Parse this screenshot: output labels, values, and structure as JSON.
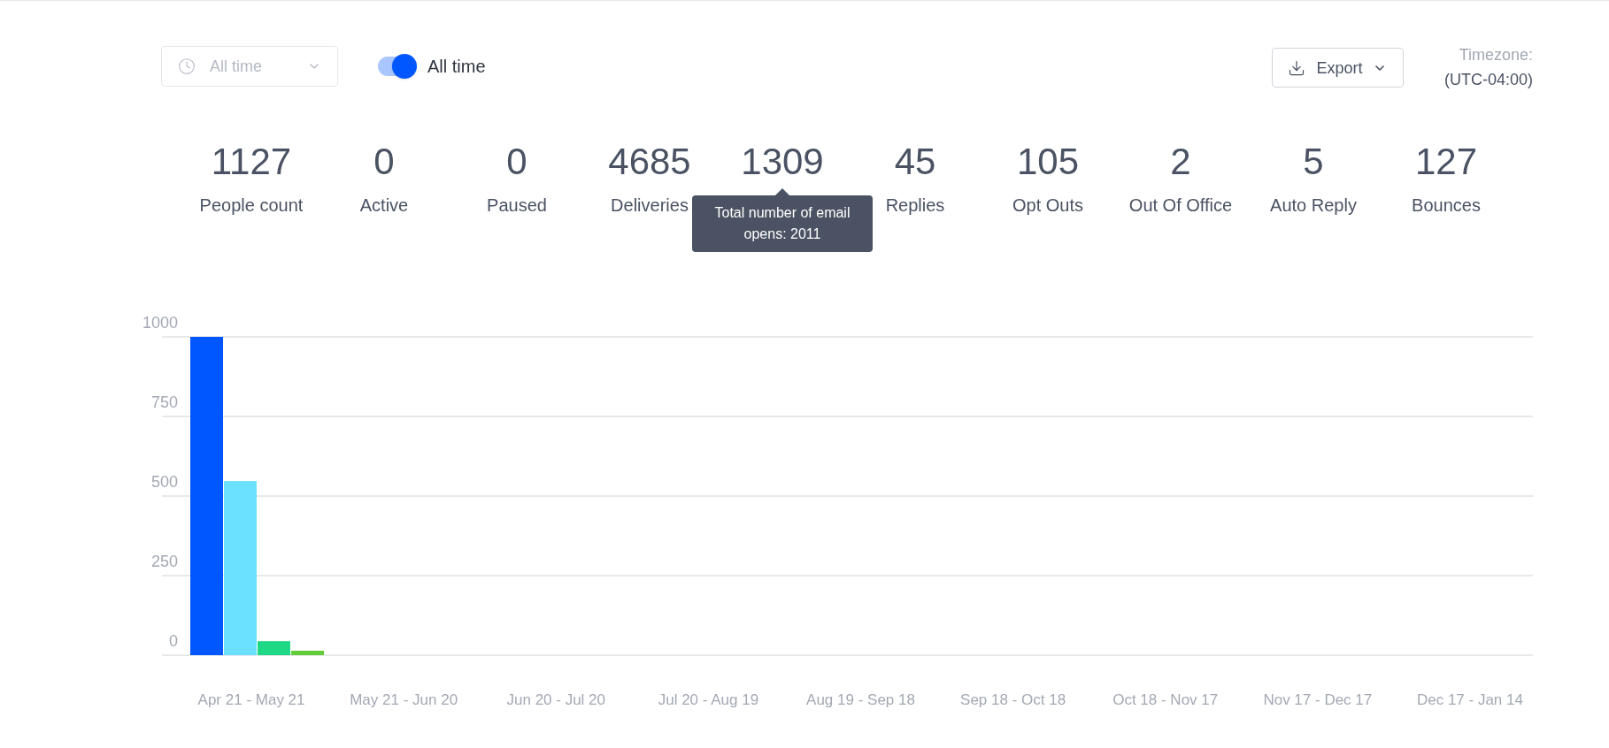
{
  "date_filter": {
    "value": "All time"
  },
  "toggle": {
    "on": true,
    "label": "All time"
  },
  "export_button": {
    "label": "Export"
  },
  "timezone": {
    "label": "Timezone:",
    "value": "(UTC-04:00)"
  },
  "stats": [
    {
      "value": "1127",
      "label": "People count"
    },
    {
      "value": "0",
      "label": "Active"
    },
    {
      "value": "0",
      "label": "Paused"
    },
    {
      "value": "4685",
      "label": "Deliveries"
    },
    {
      "value": "1309",
      "tooltip": "Total number of email opens: 2011"
    },
    {
      "value": "45",
      "label": "Replies"
    },
    {
      "value": "105",
      "label": "Opt Outs"
    },
    {
      "value": "2",
      "label": "Out Of Office"
    },
    {
      "value": "5",
      "label": "Auto Reply"
    },
    {
      "value": "127",
      "label": "Bounces"
    }
  ],
  "chart_data": {
    "type": "bar",
    "categories": [
      "Apr 21 - May 21",
      "May 21 - Jun 20",
      "Jun 20 - Jul 20",
      "Jul 20 - Aug 19",
      "Aug 19 - Sep 18",
      "Sep 18 - Oct 18",
      "Oct 18 - Nov 17",
      "Nov 17 - Dec 17",
      "Dec 17 - Jan 14"
    ],
    "series": [
      {
        "color": "#0057ff",
        "values": [
          1000,
          0,
          0,
          0,
          0,
          0,
          0,
          0,
          0
        ]
      },
      {
        "color": "#6be1ff",
        "values": [
          547,
          0,
          0,
          0,
          0,
          0,
          0,
          0,
          0
        ]
      },
      {
        "color": "#1ed886",
        "values": [
          44,
          0,
          0,
          0,
          0,
          0,
          0,
          0,
          0
        ]
      },
      {
        "color": "#63cc3a",
        "values": [
          14,
          0,
          0,
          0,
          0,
          0,
          0,
          0,
          0
        ]
      }
    ],
    "ylim": [
      0,
      1000
    ],
    "grid": true,
    "yticks": [
      0,
      250,
      500,
      750,
      1000
    ]
  }
}
